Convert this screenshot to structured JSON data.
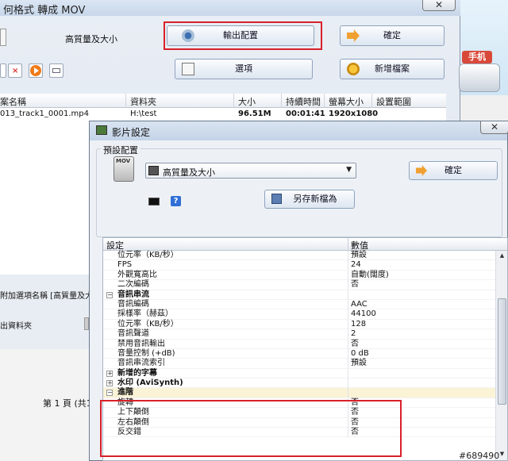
{
  "background_window": {
    "title": "何格式 轉成 MOV",
    "close_glyph": "✕",
    "quality_label": "高質量及大小",
    "output_config_button": "輸出配置",
    "confirm_button": "確定",
    "options_button": "選項",
    "add_file_button": "新增檔案",
    "table": {
      "headers": [
        "案名稱",
        "資料夾",
        "大小",
        "持續時間",
        "螢幕大小",
        "設置範圍"
      ],
      "rows": [
        [
          "013_track1_0001.mp4",
          "H:\\test",
          "96.51M",
          "00:01:41",
          "1920x1080",
          ""
        ]
      ]
    },
    "append_option_text": "附加選項名稱 [高質量及大",
    "output_folder_text": "出資料夾",
    "page_text": "第 1 頁 (共1"
  },
  "side_strip": {
    "phone_label": "手机"
  },
  "dialog": {
    "title": "影片設定",
    "close_glyph": "✕",
    "preset_group_label": "預設配置",
    "preset_icon_label": "MOV",
    "preset_value": "高質量及大小",
    "confirm_button": "確定",
    "save_as_button": "另存新檔為",
    "help_glyph": "?",
    "grid": {
      "col_setting": "設定",
      "col_value": "數值",
      "rows": [
        {
          "name": "位元率（KB/秒）",
          "value": "預設",
          "type": "item"
        },
        {
          "name": "FPS",
          "value": "24",
          "type": "item"
        },
        {
          "name": "外觀寬高比",
          "value": "自動(闊度)",
          "type": "item"
        },
        {
          "name": "二次編碼",
          "value": "否",
          "type": "item"
        },
        {
          "name": "音訊串流",
          "value": "",
          "type": "cat",
          "toggle": "−"
        },
        {
          "name": "音訊編碼",
          "value": "AAC",
          "type": "item"
        },
        {
          "name": "採樣率（赫茲）",
          "value": "44100",
          "type": "item"
        },
        {
          "name": "位元率（KB/秒）",
          "value": "128",
          "type": "item"
        },
        {
          "name": "音訊聲道",
          "value": "2",
          "type": "item"
        },
        {
          "name": "禁用音訊輸出",
          "value": "否",
          "type": "item"
        },
        {
          "name": "音量控制 (+dB)",
          "value": "0 dB",
          "type": "item"
        },
        {
          "name": "音訊串流索引",
          "value": "預設",
          "type": "item"
        },
        {
          "name": "新增的字幕",
          "value": "",
          "type": "cat",
          "toggle": "+"
        },
        {
          "name": "水印 (AviSynth)",
          "value": "",
          "type": "cat",
          "toggle": "+"
        },
        {
          "name": "進階",
          "value": "",
          "type": "cat",
          "toggle": "−"
        },
        {
          "name": "旋轉",
          "value": "否",
          "type": "item"
        },
        {
          "name": "上下顛倒",
          "value": "否",
          "type": "item"
        },
        {
          "name": "左右顛倒",
          "value": "否",
          "type": "item"
        },
        {
          "name": "反交錯",
          "value": "否",
          "type": "item"
        }
      ]
    }
  },
  "watermark": "#689490",
  "colors": {
    "highlight_red": "#d8202a"
  }
}
